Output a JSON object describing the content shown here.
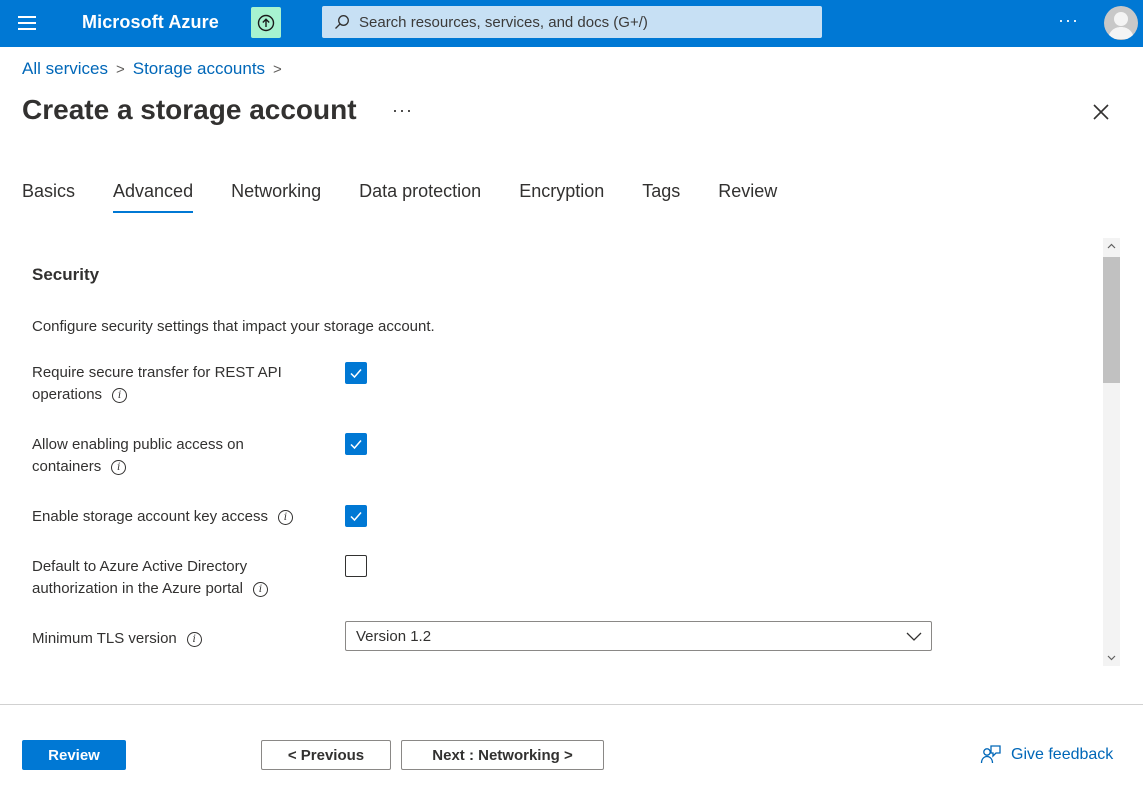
{
  "topbar": {
    "brand": "Microsoft Azure",
    "search_placeholder": "Search resources, services, and docs (G+/)",
    "more": "···",
    "accent_color": "#0078d4",
    "icons": [
      "hamburger-icon",
      "upgrade-icon",
      "search-icon",
      "avatar-icon"
    ]
  },
  "breadcrumb": {
    "items": [
      "All services",
      "Storage accounts"
    ],
    "separator": ">"
  },
  "page": {
    "title": "Create a storage account",
    "more": "···"
  },
  "tabs": [
    "Basics",
    "Advanced",
    "Networking",
    "Data protection",
    "Encryption",
    "Tags",
    "Review"
  ],
  "active_tab": "Advanced",
  "security": {
    "title": "Security",
    "description": "Configure security settings that impact your storage account.",
    "fields": [
      {
        "label_line1": "Require secure transfer for REST API",
        "label_line2": "operations",
        "checked": true
      },
      {
        "label_line1": "Allow enabling public access on",
        "label_line2": "containers",
        "checked": true
      },
      {
        "label_line1": "Enable storage account key access",
        "label_line2": "",
        "checked": true
      },
      {
        "label_line1": "Default to Azure Active Directory",
        "label_line2": "authorization in the Azure portal",
        "checked": false
      }
    ],
    "tls": {
      "label": "Minimum TLS version",
      "value": "Version 1.2"
    }
  },
  "footer": {
    "review": "Review",
    "previous": "< Previous",
    "next": "Next : Networking >",
    "feedback": "Give feedback"
  }
}
